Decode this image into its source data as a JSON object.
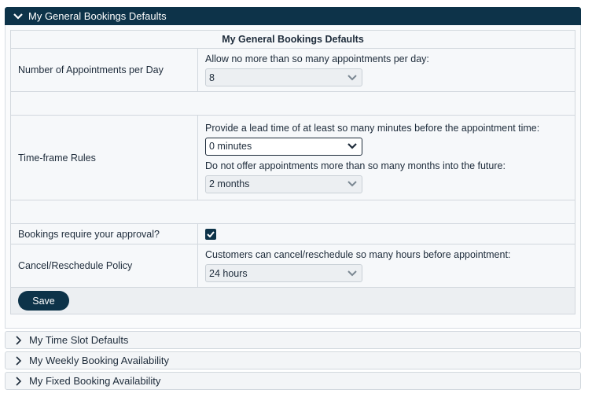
{
  "panel": {
    "title": "My General Bookings Defaults"
  },
  "table": {
    "title": "My General Bookings Defaults",
    "appointments": {
      "label": "Number of Appointments per Day",
      "prompt": "Allow no more than so many appointments per day:",
      "value": "8"
    },
    "timeframe": {
      "label": "Time-frame Rules",
      "lead_prompt": "Provide a lead time of at least so many minutes before the appointment time:",
      "lead_value": "0 minutes",
      "future_prompt": "Do not offer appointments more than so many months into the future:",
      "future_value": "2 months"
    },
    "approval": {
      "label": "Bookings require your approval?",
      "checked": true
    },
    "cancel": {
      "label": "Cancel/Reschedule Policy",
      "prompt": "Customers can cancel/reschedule so many hours before appointment:",
      "value": "24 hours"
    },
    "save_label": "Save"
  },
  "accordions": [
    {
      "label": "My Time Slot Defaults"
    },
    {
      "label": "My Weekly Booking Availability"
    },
    {
      "label": "My Fixed Booking Availability"
    }
  ],
  "colors": {
    "header_bg": "#0d3349",
    "accent": "#0d3349"
  }
}
